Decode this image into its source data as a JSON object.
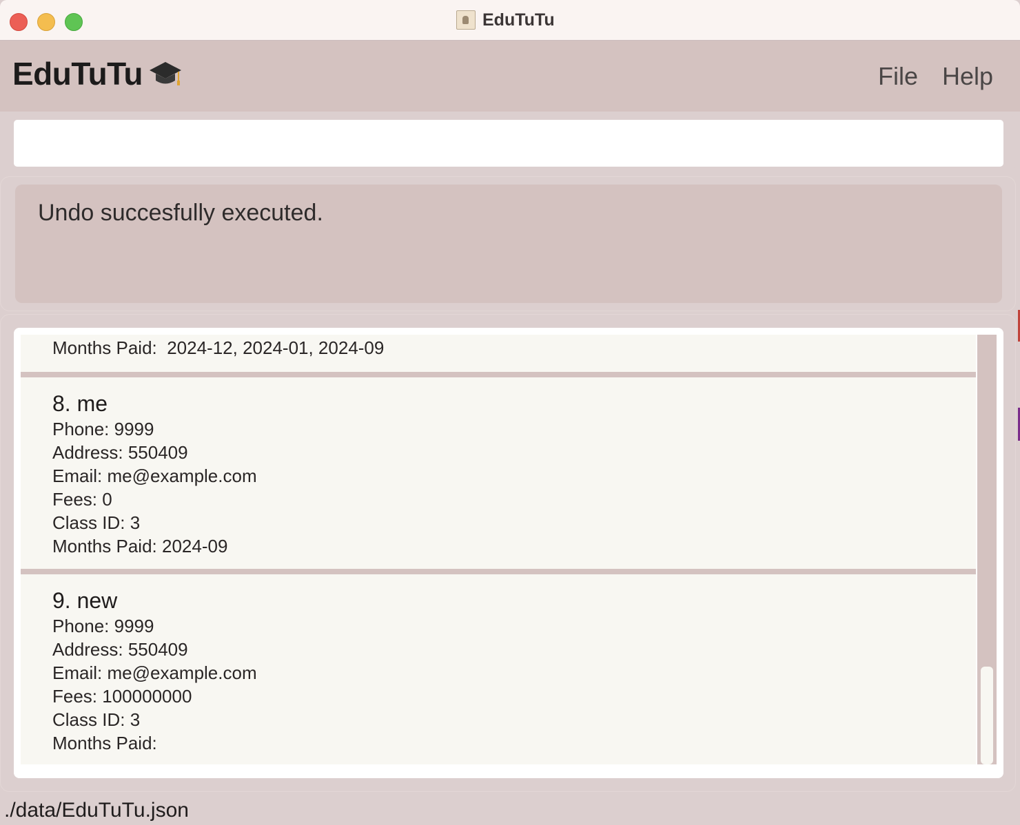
{
  "window": {
    "title": "EduTuTu"
  },
  "app": {
    "brand": "EduTuTu",
    "menu": {
      "file": "File",
      "help": "Help"
    }
  },
  "command_box": {
    "value": "",
    "placeholder": ""
  },
  "result_display": {
    "message": "Undo succesfully executed."
  },
  "list": {
    "partial_card": {
      "months_paid_label": "Months Paid:",
      "months_paid": "2024-12, 2024-01, 2024-09"
    },
    "cards": [
      {
        "index_name": "8. me",
        "phone_label": "Phone:",
        "phone": "9999",
        "address_label": "Address:",
        "address": "550409",
        "email_label": "Email:",
        "email": "me@example.com",
        "fees_label": "Fees:",
        "fees": "0",
        "class_label": "Class ID:",
        "class_id": "3",
        "months_paid_label": "Months Paid:",
        "months_paid": "2024-09"
      },
      {
        "index_name": "9. new",
        "phone_label": "Phone:",
        "phone": "9999",
        "address_label": "Address:",
        "address": "550409",
        "email_label": "Email:",
        "email": "me@example.com",
        "fees_label": "Fees:",
        "fees": "100000000",
        "class_label": "Class ID:",
        "class_id": "3",
        "months_paid_label": "Months Paid:",
        "months_paid": ""
      }
    ]
  },
  "status_bar": {
    "path": "./data/EduTuTu.json"
  },
  "colors": {
    "header_bg": "#d4c2c0",
    "panel_bg": "#dccfcf",
    "card_bg": "#f8f7f2"
  }
}
